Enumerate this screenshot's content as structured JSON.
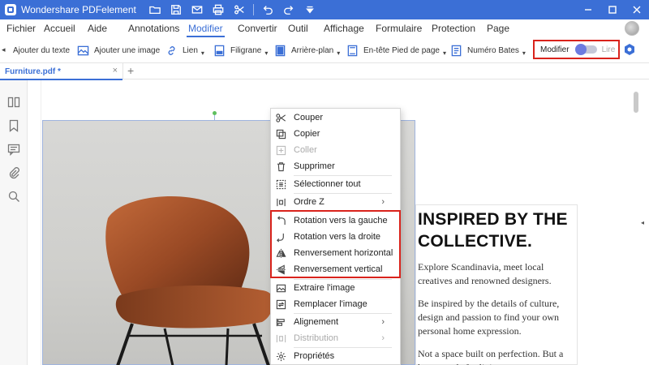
{
  "app": {
    "title": "Wondershare PDFelement"
  },
  "menu": [
    "Fichier",
    "Accueil",
    "Aide",
    "Annotations",
    "Modifier",
    "Convertir",
    "Outil",
    "Affichage",
    "Formulaire",
    "Protection",
    "Page"
  ],
  "menu_active": "Modifier",
  "toolbar": {
    "items": [
      {
        "label": "Ajouter du texte",
        "icon": "text-box-icon"
      },
      {
        "label": "Ajouter une image",
        "icon": "image-icon"
      },
      {
        "label": "Lien",
        "icon": "link-icon"
      },
      {
        "label": "Filigrane",
        "icon": "watermark-icon"
      },
      {
        "label": "Arrière-plan",
        "icon": "background-icon"
      },
      {
        "label": "En-tête  Pied de page",
        "icon": "header-footer-icon"
      },
      {
        "label": "Numéro Bates",
        "icon": "bates-icon"
      }
    ],
    "mode_edit": "Modifier",
    "mode_read": "Lire",
    "accent": "#3b6fd6",
    "highlight": "#d9231c"
  },
  "tab": {
    "name": "Furniture.pdf *",
    "close": "×",
    "add": "+"
  },
  "document": {
    "heading": "INSPIRED BY THE COLLECTIVE.",
    "paragraphs": [
      "Explore Scandinavia, meet local creatives and renowned designers.",
      "Be inspired by the details of culture, design and passion to find your own personal home expression.",
      "Not a space built on perfection. But a home made for living."
    ]
  },
  "context_menu": {
    "items": [
      {
        "label": "Couper",
        "icon": "scissors-icon",
        "enabled": true
      },
      {
        "label": "Copier",
        "icon": "copy-icon",
        "enabled": true
      },
      {
        "label": "Coller",
        "icon": "paste-icon",
        "enabled": false
      },
      {
        "label": "Supprimer",
        "icon": "trash-icon",
        "enabled": true
      },
      {
        "label": "Sélectionner tout",
        "icon": "select-all-icon",
        "enabled": true
      },
      {
        "label": "Ordre Z",
        "icon": "z-order-icon",
        "enabled": true,
        "submenu": true
      },
      {
        "label": "Rotation vers la gauche",
        "icon": "rotate-left-icon",
        "enabled": true
      },
      {
        "label": "Rotation vers la droite",
        "icon": "rotate-right-icon",
        "enabled": true
      },
      {
        "label": "Renversement horizontal",
        "icon": "flip-horizontal-icon",
        "enabled": true
      },
      {
        "label": "Renversement vertical",
        "icon": "flip-vertical-icon",
        "enabled": true
      },
      {
        "label": "Extraire l'image",
        "icon": "extract-image-icon",
        "enabled": true
      },
      {
        "label": "Remplacer l'image",
        "icon": "replace-image-icon",
        "enabled": true
      },
      {
        "label": "Alignement",
        "icon": "align-icon",
        "enabled": true,
        "submenu": true
      },
      {
        "label": "Distribution",
        "icon": "distribute-icon",
        "enabled": false,
        "submenu": true
      },
      {
        "label": "Propriétés",
        "icon": "settings-gear-icon",
        "enabled": true
      }
    ],
    "submenu_arrow": "›"
  }
}
